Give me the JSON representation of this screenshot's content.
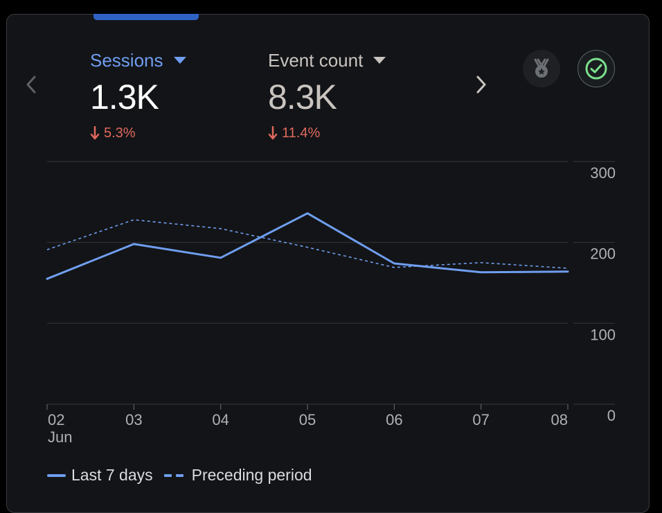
{
  "metrics": {
    "sessions": {
      "label": "Sessions",
      "value": "1.3K",
      "change": "5.3%"
    },
    "event_count": {
      "label": "Event count",
      "value": "8.3K",
      "change": "11.4%"
    }
  },
  "icons": {
    "prev": "chevron-left-icon",
    "next": "chevron-right-icon",
    "metric_dropdown": "caret-down-icon",
    "change_direction": "arrow-down-icon",
    "award": "award-medal-icon",
    "status": "check-circle-icon"
  },
  "colors": {
    "background": "#131417",
    "accent": "#6f9ef0",
    "negative": "#e06a5f",
    "status_ok": "#7be08e",
    "grid": "#303236"
  },
  "chart_data": {
    "type": "line",
    "x": [
      "02",
      "03",
      "04",
      "05",
      "06",
      "07",
      "08"
    ],
    "x_sublabel": "Jun",
    "ylim": [
      0,
      300
    ],
    "yticks": [
      300,
      200,
      100,
      0
    ],
    "y_axis_side": "right",
    "grid": true,
    "series": [
      {
        "name": "Last 7 days",
        "style": "solid",
        "values": [
          155,
          198,
          181,
          236,
          174,
          163,
          164
        ]
      },
      {
        "name": "Preceding period",
        "style": "dashed",
        "values": [
          191,
          228,
          217,
          194,
          169,
          175,
          168
        ]
      }
    ],
    "legend_position": "bottom-left"
  }
}
